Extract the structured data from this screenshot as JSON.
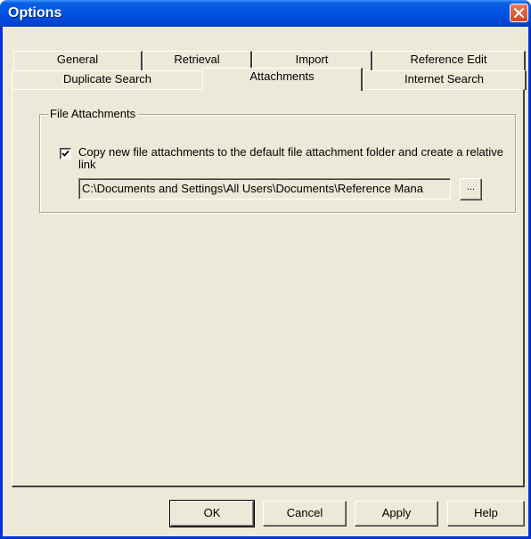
{
  "window": {
    "title": "Options"
  },
  "tabs_back_row": [
    {
      "label": "General"
    },
    {
      "label": "Retrieval"
    },
    {
      "label": "Import"
    },
    {
      "label": "Reference Edit"
    }
  ],
  "tabs_front_row": [
    {
      "label": "Duplicate Search"
    },
    {
      "label": "Attachments",
      "active": true
    },
    {
      "label": "Internet Search"
    }
  ],
  "file_attachments": {
    "group_label": "File Attachments",
    "copy_checkbox": {
      "checked": true,
      "label": "Copy new file attachments to the default file attachment folder and create a relative link"
    },
    "folder_path": "C:\\Documents and Settings\\All Users\\Documents\\Reference Mana",
    "browse_label": "..."
  },
  "buttons": {
    "ok": "OK",
    "cancel": "Cancel",
    "apply": "Apply",
    "help": "Help"
  },
  "colors": {
    "titlebar": "#0055e5",
    "dialog_face": "#ece9d8",
    "close_button": "#d2451c"
  }
}
